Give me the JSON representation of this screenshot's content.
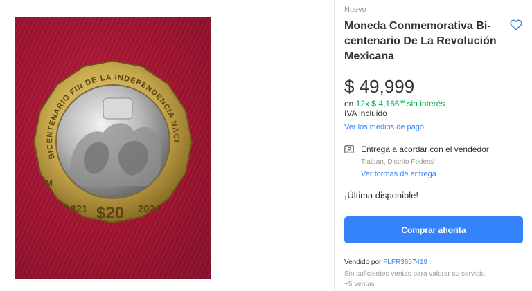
{
  "product": {
    "condition": "Nuevo",
    "title": "Moneda Conmemorativa Bi-centenario De La Revolución Mexicana",
    "image": {
      "coin_inscription": "BICENTENARIO FIN DE LA INDEPENDENCIA NACIONAL",
      "year_left": "1821",
      "year_right": "2021",
      "denomination": "$20",
      "mint_mark": "M"
    }
  },
  "price": {
    "amount": "$ 49,999",
    "installments_prefix": "en",
    "installments_count": "12x",
    "installment_amount": "$ 4,166",
    "installment_cents": "58",
    "installments_suffix": "sin interés",
    "tax_note": "IVA incluido",
    "payment_methods_link": "Ver los medios de pago"
  },
  "shipping": {
    "text": "Entrega a acordar con el vendedor",
    "location": "Tlalpan, Distrito Federal",
    "link": "Ver formas de entrega"
  },
  "stock": {
    "label": "¡Última disponible!"
  },
  "actions": {
    "buy_now": "Comprar ahorita"
  },
  "seller": {
    "prefix": "Vendido por",
    "name": "FLFR3657419",
    "note": "Sin suficientes ventas para valorar su servicio.",
    "sales": "+5 ventas"
  },
  "colors": {
    "accent": "#3483fa",
    "installments": "#00a650",
    "muted": "#999999"
  },
  "icons": {
    "favorite": "heart-outline-icon",
    "shipping": "shipping-icon"
  }
}
